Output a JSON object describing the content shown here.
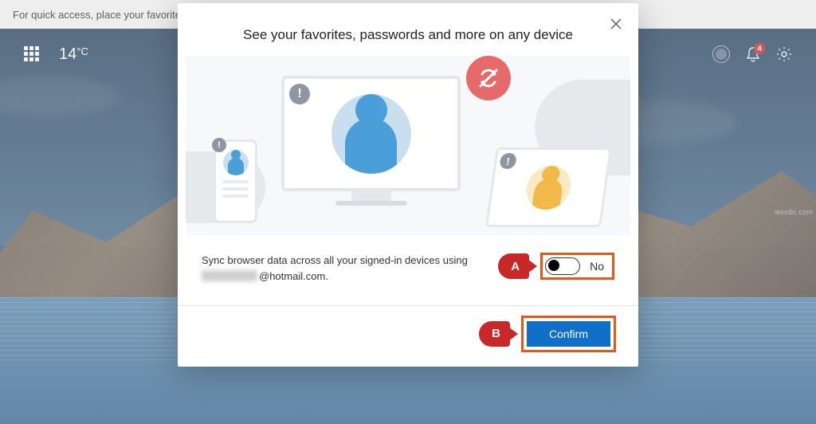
{
  "browser": {
    "favorites_hint": "For quick access, place your favorites h"
  },
  "page_topbar": {
    "temperature": "14",
    "temperature_unit": "°C",
    "notification_count": "4"
  },
  "dialog": {
    "title": "See your favorites, passwords and more on any device",
    "sync_text_prefix": "Sync browser data across all your signed-in devices using",
    "email_domain": "@hotmail.com.",
    "toggle_label": "No",
    "confirm_label": "Confirm",
    "callout_a": "A",
    "callout_b": "B"
  },
  "watermark": "wsxdn.com"
}
